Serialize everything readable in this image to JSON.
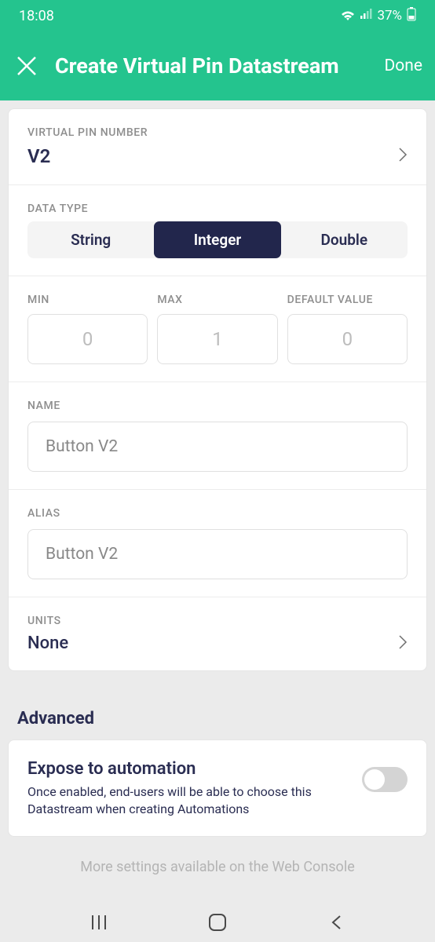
{
  "status_bar": {
    "time": "18:08",
    "battery": "37%"
  },
  "header": {
    "title": "Create Virtual Pin Datastream",
    "done": "Done"
  },
  "pin": {
    "label": "VIRTUAL PIN NUMBER",
    "value": "V2"
  },
  "data_type": {
    "label": "DATA TYPE",
    "options": [
      "String",
      "Integer",
      "Double"
    ],
    "selected": "Integer"
  },
  "min": {
    "label": "MIN",
    "value": "0"
  },
  "max": {
    "label": "MAX",
    "value": "1"
  },
  "default": {
    "label": "DEFAULT VALUE",
    "value": "0"
  },
  "name": {
    "label": "NAME",
    "value": "Button V2"
  },
  "alias": {
    "label": "ALIAS",
    "value": "Button V2"
  },
  "units": {
    "label": "UNITS",
    "value": "None"
  },
  "advanced": {
    "label": "Advanced",
    "expose": {
      "title": "Expose to automation",
      "desc": "Once enabled, end-users will be able to choose this Datastream when creating Automations"
    },
    "footer": "More settings available on the Web Console"
  }
}
